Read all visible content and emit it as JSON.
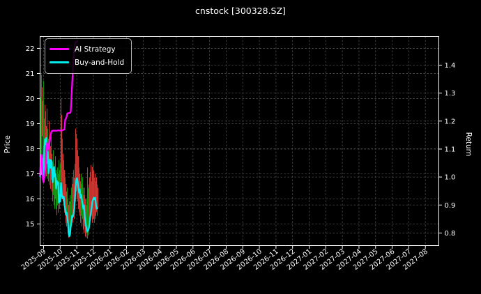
{
  "title": "cnstock [300328.SZ]",
  "legend": {
    "items": [
      {
        "label": "AI Strategy",
        "color": "#ff00ff"
      },
      {
        "label": "Buy-and-Hold",
        "color": "#00eeee"
      }
    ]
  },
  "chart_data": {
    "type": "candlestick+line",
    "title": "cnstock [300328.SZ]",
    "grid": true,
    "legend_position": "upper-left",
    "x_axis": {
      "tick_labels": [
        "2025-09",
        "2025-10",
        "2025-11",
        "2025-12",
        "2026-01",
        "2026-02",
        "2026-03",
        "2026-04",
        "2026-05",
        "2026-06",
        "2026-07",
        "2026-08",
        "2026-09",
        "2026-10",
        "2026-11",
        "2026-12",
        "2027-01",
        "2027-02",
        "2027-03",
        "2027-04",
        "2027-05",
        "2027-06",
        "2027-07",
        "2027-08"
      ],
      "xlim_months": [
        -0.21,
        23.81
      ]
    },
    "y_left": {
      "label": "Price",
      "ticks": [
        15,
        16,
        17,
        18,
        19,
        20,
        21,
        22
      ],
      "ylim": [
        14.14,
        22.47
      ]
    },
    "y_right": {
      "label": "Return",
      "ticks": [
        0.8,
        0.9,
        1.0,
        1.1,
        1.2,
        1.3,
        1.4
      ],
      "ylim": [
        0.755,
        1.502
      ]
    },
    "series_meta": {
      "m_start": -0.21,
      "m_step": 0.042,
      "note": "m = months since 2025-09-01; candles and line points share this daily spacing"
    },
    "colors": {
      "up": "#0a930a",
      "down": "#d13535",
      "grid": "#4d4d4d",
      "bg": "#000000",
      "fg": "#ffffff",
      "ai": "#ff00ff",
      "bh": "#00eeee"
    },
    "candles_format": [
      "high",
      "low",
      "up(1)/down(0)"
    ],
    "candles": [
      [
        20.45,
        16.85,
        1
      ],
      [
        20.05,
        17.0,
        1
      ],
      [
        20.95,
        17.8,
        1
      ],
      [
        20.45,
        18.5,
        0
      ],
      [
        19.9,
        17.55,
        0
      ],
      [
        20.7,
        17.1,
        1
      ],
      [
        19.2,
        16.95,
        1
      ],
      [
        19.75,
        17.25,
        0
      ],
      [
        19.5,
        17.5,
        1
      ],
      [
        18.9,
        16.9,
        0
      ],
      [
        19.6,
        17.4,
        0
      ],
      [
        18.8,
        16.8,
        1
      ],
      [
        18.4,
        16.7,
        0
      ],
      [
        19.1,
        17.1,
        0
      ],
      [
        18.4,
        16.55,
        1
      ],
      [
        18.1,
        16.4,
        0
      ],
      [
        18.5,
        16.75,
        1
      ],
      [
        17.8,
        16.3,
        0
      ],
      [
        17.5,
        15.9,
        0
      ],
      [
        17.95,
        16.15,
        1
      ],
      [
        17.4,
        15.75,
        0
      ],
      [
        17.3,
        15.6,
        1
      ],
      [
        17.7,
        16.0,
        0
      ],
      [
        17.15,
        15.6,
        1
      ],
      [
        16.85,
        15.35,
        0
      ],
      [
        17.25,
        15.75,
        1
      ],
      [
        17.0,
        15.45,
        0
      ],
      [
        17.55,
        15.9,
        1
      ],
      [
        17.15,
        15.6,
        0
      ],
      [
        17.4,
        15.9,
        1
      ],
      [
        20.0,
        16.7,
        0
      ],
      [
        19.35,
        16.3,
        0
      ],
      [
        18.4,
        16.15,
        1
      ],
      [
        17.8,
        15.9,
        0
      ],
      [
        17.55,
        15.75,
        1
      ],
      [
        17.15,
        15.45,
        0
      ],
      [
        16.85,
        15.33,
        1
      ],
      [
        16.6,
        15.05,
        0
      ],
      [
        16.3,
        14.9,
        0
      ],
      [
        16.45,
        15.05,
        1
      ],
      [
        16.0,
        14.65,
        0
      ],
      [
        15.75,
        14.45,
        0
      ],
      [
        15.9,
        14.5,
        1
      ],
      [
        16.15,
        14.8,
        1
      ],
      [
        15.9,
        14.65,
        0
      ],
      [
        16.45,
        14.9,
        1
      ],
      [
        16.85,
        15.2,
        1
      ],
      [
        16.6,
        15.05,
        0
      ],
      [
        17.15,
        15.45,
        1
      ],
      [
        16.85,
        15.2,
        0
      ],
      [
        17.4,
        15.6,
        1
      ],
      [
        18.8,
        15.9,
        0
      ],
      [
        18.6,
        16.3,
        1
      ],
      [
        18.4,
        16.0,
        0
      ],
      [
        17.95,
        15.9,
        1
      ],
      [
        17.7,
        15.6,
        0
      ],
      [
        17.25,
        15.47,
        1
      ],
      [
        17.0,
        15.33,
        0
      ],
      [
        16.7,
        15.05,
        0
      ],
      [
        17.0,
        15.33,
        1
      ],
      [
        16.6,
        14.9,
        0
      ],
      [
        16.85,
        15.2,
        1
      ],
      [
        16.45,
        14.78,
        0
      ],
      [
        16.15,
        14.64,
        0
      ],
      [
        16.45,
        14.9,
        1
      ],
      [
        16.0,
        14.5,
        0
      ],
      [
        15.75,
        14.45,
        0
      ],
      [
        16.0,
        14.64,
        1
      ],
      [
        17.25,
        14.42,
        0
      ],
      [
        16.44,
        14.55,
        1
      ],
      [
        16.58,
        14.8,
        1
      ],
      [
        16.85,
        15.05,
        0
      ],
      [
        17.07,
        15.2,
        1
      ],
      [
        17.35,
        15.47,
        0
      ],
      [
        16.7,
        15.33,
        1
      ],
      [
        17.27,
        15.05,
        0
      ],
      [
        17.4,
        15.2,
        1
      ],
      [
        17.13,
        15.2,
        0
      ],
      [
        16.85,
        15.05,
        1
      ],
      [
        17.0,
        15.33,
        0
      ],
      [
        16.7,
        15.2,
        1
      ],
      [
        16.85,
        15.47,
        0
      ],
      [
        16.58,
        15.33,
        1
      ],
      [
        16.44,
        15.6,
        0
      ]
    ],
    "series": [
      {
        "name": "AI Strategy",
        "axis": "right",
        "returns": [
          1.006,
          1.06,
          1.08,
          1.041,
          0.991,
          0.981,
          0.998,
          1.016,
          1.041,
          1.073,
          1.122,
          1.105,
          1.098,
          1.115,
          1.13,
          1.147,
          1.16,
          1.165,
          1.165,
          1.166,
          1.165,
          1.166,
          1.166,
          1.165,
          1.166,
          1.166,
          1.167,
          1.166,
          1.166,
          1.167,
          1.167,
          1.166,
          1.167,
          1.168,
          1.169,
          1.17,
          1.204,
          1.209,
          1.214,
          1.227,
          1.228,
          1.228,
          1.229,
          1.229,
          1.234,
          1.284,
          1.333,
          1.383,
          1.42,
          1.452,
          1.474,
          1.482,
          1.483,
          1.484,
          1.487
        ]
      },
      {
        "name": "Buy-and-Hold",
        "axis": "right",
        "returns": [
          1.003,
          1.028,
          1.011,
          1.065,
          1.018,
          1.003,
          1.098,
          1.135,
          1.117,
          1.14,
          1.07,
          1.09,
          1.013,
          1.046,
          1.063,
          1.033,
          1.06,
          1.031,
          0.981,
          1.026,
          1.036,
          1.001,
          1.011,
          0.959,
          0.986,
          0.974,
          0.981,
          0.909,
          0.936,
          0.912,
          0.979,
          0.941,
          0.924,
          0.931,
          0.929,
          0.899,
          0.887,
          0.867,
          0.874,
          0.857,
          0.837,
          0.798,
          0.788,
          0.795,
          0.825,
          0.842,
          0.862,
          0.857,
          0.867,
          0.887,
          0.924,
          0.961,
          0.991,
          0.996,
          0.981,
          0.961,
          0.944,
          0.956,
          0.926,
          0.936,
          0.917,
          0.902,
          0.887,
          0.899,
          0.862,
          0.842,
          0.825,
          0.812,
          0.805,
          0.81,
          0.817,
          0.837,
          0.857,
          0.874,
          0.892,
          0.912,
          0.919,
          0.926,
          0.921,
          0.926,
          0.907,
          0.887,
          0.889
        ]
      }
    ]
  }
}
